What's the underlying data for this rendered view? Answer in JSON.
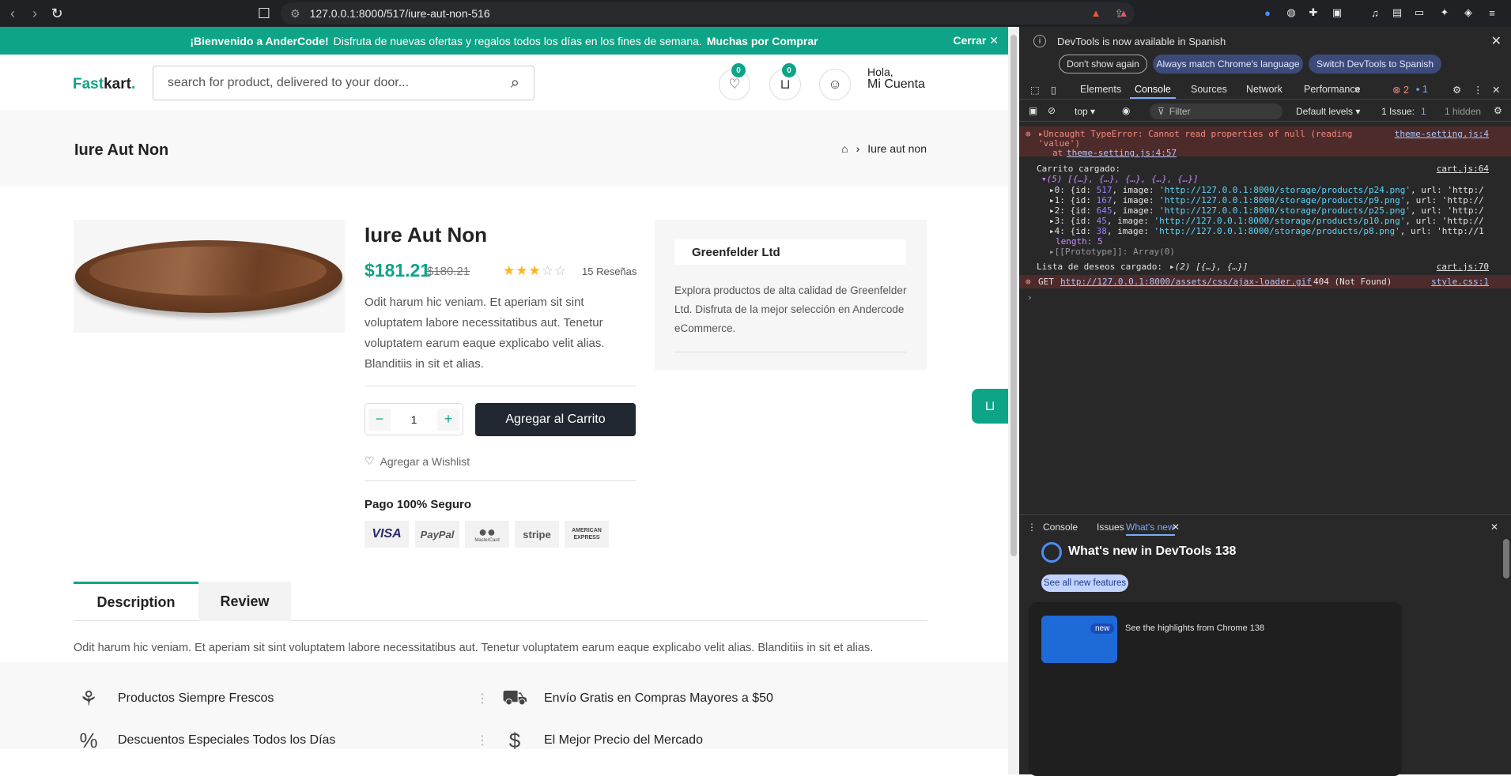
{
  "browser": {
    "url": "127.0.0.1:8000/517/iure-aut-non-516",
    "ext_badge": "1"
  },
  "promo": {
    "welcome": "¡Bienvenido a AnderCode!",
    "message": "Disfruta de nuevas ofertas y regalos todos los días en los fines de semana.",
    "thanks": "Muchas por Comprar",
    "close": "Cerrar ✕"
  },
  "header": {
    "logo_a": "Fast",
    "logo_b": "kart",
    "logo_dot": ".",
    "search_placeholder": "search for product, delivered to your door...",
    "wishlist_count": "0",
    "cart_count": "0",
    "greeting": "Hola,",
    "account": "Mi Cuenta"
  },
  "breadcrumb": {
    "title": "Iure Aut Non",
    "current": "Iure aut non"
  },
  "product": {
    "title": "Iure Aut Non",
    "price": "$181.21",
    "old_price": "$180.21",
    "rating": 3,
    "rating_max": 5,
    "reviews": "15 Reseñas",
    "description": "Odit harum hic veniam. Et aperiam sit sint voluptatem labore necessitatibus aut. Tenetur voluptatem earum eaque explicabo velit alias. Blanditiis in sit et alias.",
    "quantity": "1",
    "add_to_cart": "Agregar al Carrito",
    "wishlist": "Agregar a Wishlist",
    "secure_title": "Pago 100% Seguro",
    "payments": [
      "VISA",
      "PayPal",
      "MasterCard",
      "stripe",
      "AMERICAN EXPRESS"
    ]
  },
  "vendor": {
    "name": "Greenfelder Ltd",
    "description": "Explora productos de alta calidad de Greenfelder Ltd. Disfruta de la mejor selección en Andercode eCommerce."
  },
  "tabs": {
    "description": "Description",
    "review": "Review",
    "body": "Odit harum hic veniam. Et aperiam sit sint voluptatem labore necessitatibus aut. Tenetur voluptatem earum eaque explicabo velit alias. Blanditiis in sit et alias."
  },
  "features": [
    {
      "label": "Productos Siempre Frescos"
    },
    {
      "label": "Envío Gratis en Compras Mayores a $50"
    },
    {
      "label": "Descuentos Especiales Todos los Días"
    },
    {
      "label": "El Mejor Precio del Mercado"
    }
  ],
  "devtools": {
    "info": "DevTools is now available in Spanish",
    "btn_dont": "Don't show again",
    "btn_match": "Always match Chrome's language",
    "btn_switch": "Switch DevTools to Spanish",
    "tabs": [
      "Elements",
      "Console",
      "Sources",
      "Network",
      "Performance"
    ],
    "err_count": "2",
    "msg_count": "1",
    "context": "top ▾",
    "filter": "Filter",
    "levels": "Default levels ▾",
    "issues": "1 Issue:",
    "issues_count": "1",
    "hidden": "1 hidden",
    "err1": "▸Uncaught TypeError: Cannot read properties of null (reading",
    "err1b": "'value')",
    "err1_at": "at",
    "err1_link": "theme-setting.js:4:57",
    "err1_src": "theme-setting.js:4",
    "log1": "Carrito cargado:",
    "log1_src": "cart.js:64",
    "arr_head": "▾(5) [{…}, {…}, {…}, {…}, {…}]",
    "items": [
      {
        "idx": "▸0: {id: ",
        "id": "517",
        "img": "'http://127.0.0.1:8000/storage/products/p24.png'",
        "tail": ", url: 'http:/"
      },
      {
        "idx": "▸1: {id: ",
        "id": "167",
        "img": "'http://127.0.0.1:8000/storage/products/p9.png'",
        "tail": ", url: 'http://"
      },
      {
        "idx": "▸2: {id: ",
        "id": "645",
        "img": "'http://127.0.0.1:8000/storage/products/p25.png'",
        "tail": ", url: 'http:/"
      },
      {
        "idx": "▸3: {id: ",
        "id": "45",
        "img": "'http://127.0.0.1:8000/storage/products/p10.png'",
        "tail": ", url: 'http://"
      },
      {
        "idx": "▸4: {id: ",
        "id": "38",
        "img": "'http://127.0.0.1:8000/storage/products/p8.png'",
        "tail": ", url: 'http://1"
      }
    ],
    "length": "length: 5",
    "proto": "▸[[Prototype]]: Array(0)",
    "log2": "Lista de deseos cargado:",
    "log2_val": "▸(2) [{…}, {…}]",
    "log2_src": "cart.js:70",
    "err2_get": "GET",
    "err2_url": "http://127.0.0.1:8000/assets/css/ajax-loader.gif",
    "err2_status": "404 (Not Found)",
    "err2_src": "style.css:1",
    "bottom_tabs": [
      "Console",
      "Issues",
      "What's new"
    ],
    "wn_title": "What's new in DevTools 138",
    "see_all": "See all new features",
    "new_badge": "new",
    "card_text": "See the highlights from Chrome 138"
  }
}
